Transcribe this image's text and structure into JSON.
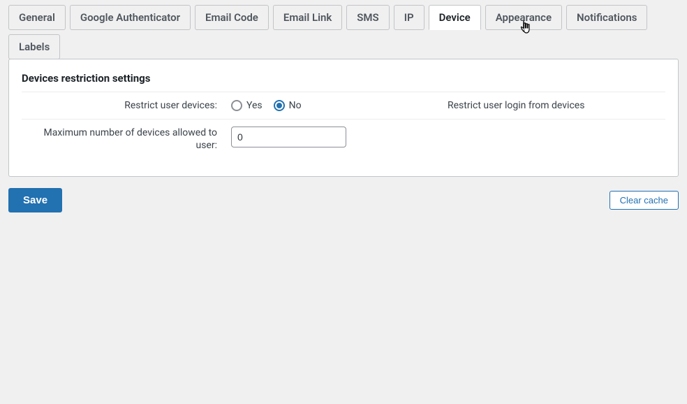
{
  "tabs": {
    "general": "General",
    "google_auth": "Google Authenticator",
    "email_code": "Email Code",
    "email_link": "Email Link",
    "sms": "SMS",
    "ip": "IP",
    "device": "Device",
    "appearance": "Appearance",
    "notifications": "Notifications",
    "labels": "Labels"
  },
  "panel": {
    "section_title": "Devices restriction settings",
    "restrict_label": "Restrict user devices:",
    "restrict_yes": "Yes",
    "restrict_no": "No",
    "restrict_help": "Restrict user login from devices",
    "max_label": "Maximum number of devices allowed to user:",
    "max_value": "0"
  },
  "actions": {
    "save": "Save",
    "clear_cache": "Clear cache"
  }
}
